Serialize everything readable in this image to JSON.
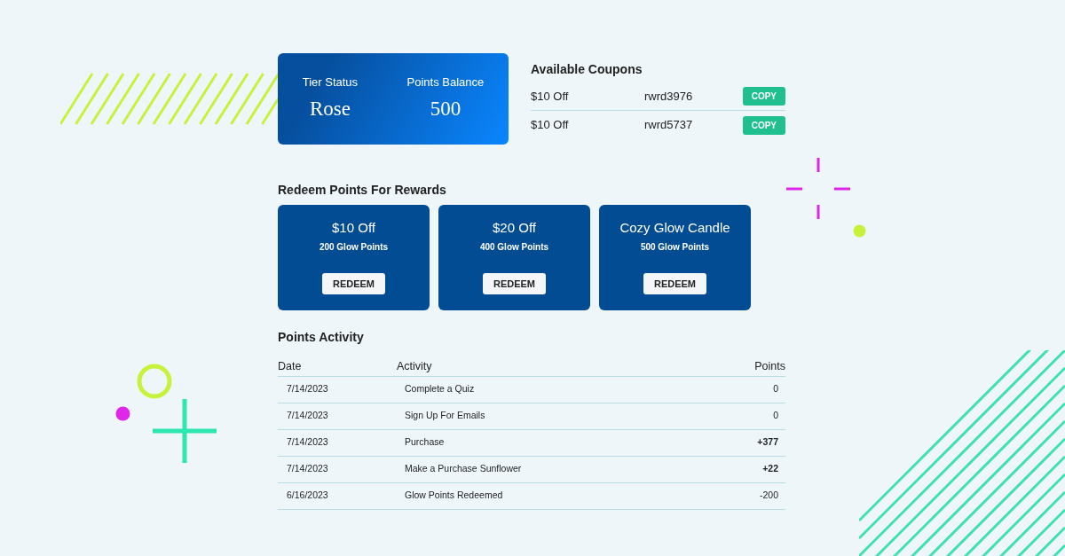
{
  "status_card": {
    "tier_label": "Tier Status",
    "tier": "Rose",
    "balance_label": "Points Balance",
    "balance": "500"
  },
  "coupons": {
    "title": "Available Coupons",
    "items": [
      {
        "name": "$10 Off",
        "code": "rwrd3976",
        "button": "COPY"
      },
      {
        "name": "$10 Off",
        "code": "rwrd5737",
        "button": "COPY"
      }
    ]
  },
  "rewards": {
    "title": "Redeem Points For Rewards",
    "items": [
      {
        "name": "$10 Off",
        "cost": "200 Glow Points",
        "button": "REDEEM"
      },
      {
        "name": "$20 Off",
        "cost": "400 Glow Points",
        "button": "REDEEM"
      },
      {
        "name": "Cozy Glow Candle",
        "cost": "500 Glow Points",
        "button": "REDEEM"
      }
    ]
  },
  "activity": {
    "title": "Points Activity",
    "columns": [
      "Date",
      "Activity",
      "Points"
    ],
    "rows": [
      {
        "date": "7/14/2023",
        "activity": "Complete a Quiz",
        "points": "0",
        "emphasized": false
      },
      {
        "date": "7/14/2023",
        "activity": "Sign Up For Emails",
        "points": "0",
        "emphasized": false
      },
      {
        "date": "7/14/2023",
        "activity": "Purchase",
        "points": "+377",
        "emphasized": true
      },
      {
        "date": "7/14/2023",
        "activity": "Make a Purchase Sunflower",
        "points": "+22",
        "emphasized": true
      },
      {
        "date": "6/16/2023",
        "activity": "Glow Points Redeemed",
        "points": "-200",
        "emphasized": false
      }
    ]
  }
}
